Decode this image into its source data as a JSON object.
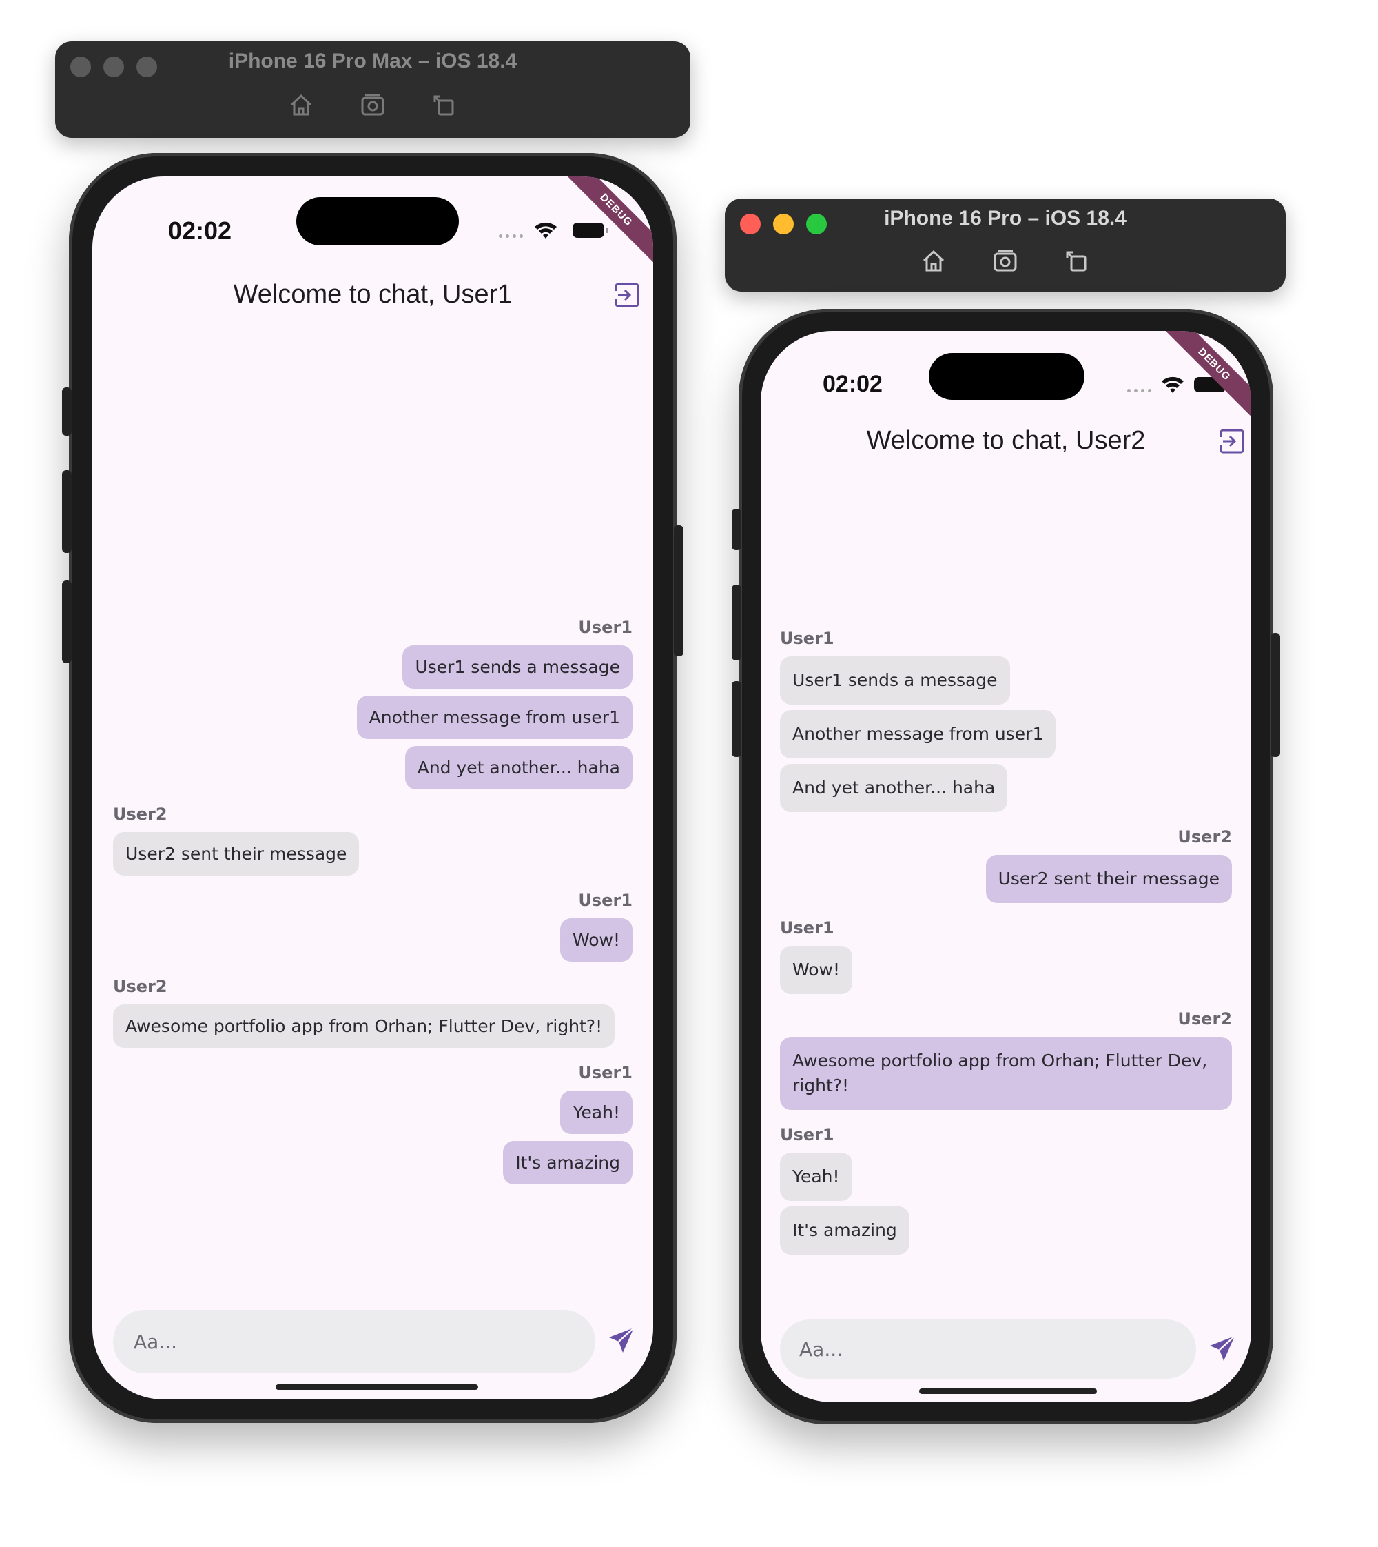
{
  "simulators": [
    {
      "title": "iPhone 16 Pro Max – iOS 18.4",
      "status_time": "02:02",
      "debug_label": "DEBUG",
      "app_title": "Welcome to chat, User1",
      "input_placeholder": "Aa...",
      "messages": [
        {
          "sender": "User1",
          "side": "right",
          "mine": true,
          "texts": [
            "User1 sends a message",
            "Another message from user1",
            "And yet another... haha"
          ]
        },
        {
          "sender": "User2",
          "side": "left",
          "mine": false,
          "texts": [
            "User2 sent their message"
          ]
        },
        {
          "sender": "User1",
          "side": "right",
          "mine": true,
          "texts": [
            "Wow!"
          ]
        },
        {
          "sender": "User2",
          "side": "left",
          "mine": false,
          "texts": [
            "Awesome portfolio app from Orhan; Flutter Dev, right?!"
          ]
        },
        {
          "sender": "User1",
          "side": "right",
          "mine": true,
          "texts": [
            "Yeah!",
            "It's amazing"
          ]
        }
      ]
    },
    {
      "title": "iPhone 16 Pro – iOS 18.4",
      "status_time": "02:02",
      "debug_label": "DEBUG",
      "app_title": "Welcome to chat, User2",
      "input_placeholder": "Aa...",
      "messages": [
        {
          "sender": "User1",
          "side": "left",
          "mine": false,
          "texts": [
            "User1 sends a message",
            "Another message from user1",
            "And yet another... haha"
          ]
        },
        {
          "sender": "User2",
          "side": "right",
          "mine": true,
          "texts": [
            "User2 sent their message"
          ]
        },
        {
          "sender": "User1",
          "side": "left",
          "mine": false,
          "texts": [
            "Wow!"
          ]
        },
        {
          "sender": "User2",
          "side": "right",
          "mine": true,
          "texts": [
            "Awesome portfolio app from Orhan; Flutter Dev, right?!"
          ]
        },
        {
          "sender": "User1",
          "side": "left",
          "mine": false,
          "texts": [
            "Yeah!",
            "It's amazing"
          ]
        }
      ]
    }
  ],
  "toolbar_icons": [
    "home-icon",
    "screenshot-icon",
    "rotate-icon"
  ],
  "colors": {
    "my_bubble": "#d3c4e5",
    "other_bubble": "#e6e4e6",
    "screen_bg": "#fdf7fd",
    "accent": "#6750a4",
    "debug_ribbon": "#7a3b5e",
    "traffic_red": "#ff5f57",
    "traffic_yellow": "#febc2e",
    "traffic_green": "#28c840"
  }
}
